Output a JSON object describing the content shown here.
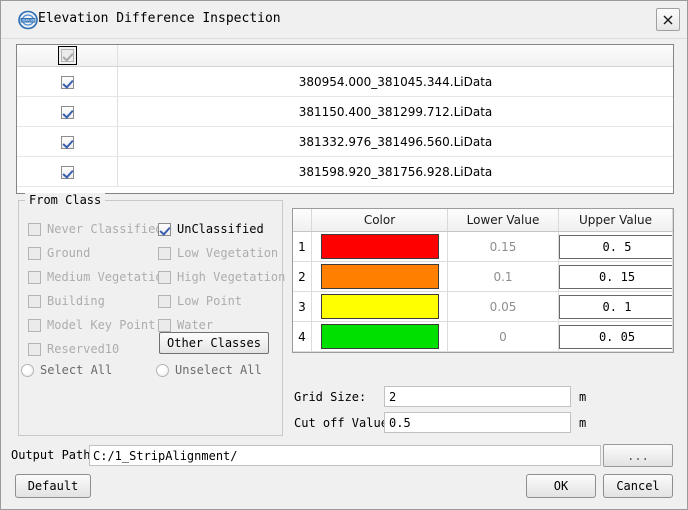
{
  "window": {
    "title": "Elevation Difference Inspection",
    "app_icon": "lidar360-logo-icon",
    "close_label": "close-icon"
  },
  "file_list": {
    "header_checkbox_state": "checked-disabled",
    "rows": [
      {
        "checked": true,
        "name": "380954.000_381045.344.LiData"
      },
      {
        "checked": true,
        "name": "381150.400_381299.712.LiData"
      },
      {
        "checked": true,
        "name": "381332.976_381496.560.LiData"
      },
      {
        "checked": true,
        "name": "381598.920_381756.928.LiData"
      }
    ]
  },
  "from_class": {
    "legend": "From Class",
    "items": [
      {
        "label": "Never Classified",
        "checked": false,
        "enabled": false
      },
      {
        "label": "UnClassified",
        "checked": true,
        "enabled": true
      },
      {
        "label": "Ground",
        "checked": false,
        "enabled": false
      },
      {
        "label": "Low Vegetation",
        "checked": false,
        "enabled": false
      },
      {
        "label": "Medium Vegetation",
        "checked": false,
        "enabled": false
      },
      {
        "label": "High Vegetation",
        "checked": false,
        "enabled": false
      },
      {
        "label": "Building",
        "checked": false,
        "enabled": false
      },
      {
        "label": "Low Point",
        "checked": false,
        "enabled": false
      },
      {
        "label": "Model Key Point",
        "checked": false,
        "enabled": false
      },
      {
        "label": "Water",
        "checked": false,
        "enabled": false
      },
      {
        "label": "Reserved10",
        "checked": false,
        "enabled": false
      }
    ],
    "other_classes_label": "Other Classes",
    "select_all_label": "Select All",
    "unselect_all_label": "Unselect All",
    "select_all_checked": false,
    "unselect_all_checked": false
  },
  "color_table": {
    "headers": {
      "index": "",
      "color": "Color",
      "lower": "Lower Value",
      "upper": "Upper Value"
    },
    "rows": [
      {
        "index": "1",
        "color": "#FF0000",
        "lower": "0.15",
        "upper": "0. 5"
      },
      {
        "index": "2",
        "color": "#FF8000",
        "lower": "0.1",
        "upper": "0. 15"
      },
      {
        "index": "3",
        "color": "#FFFF00",
        "lower": "0.05",
        "upper": "0. 1"
      },
      {
        "index": "4",
        "color": "#00E000",
        "lower": "0",
        "upper": "0. 05"
      }
    ]
  },
  "parameters": {
    "grid_size_label": "Grid Size:",
    "grid_size_value": "2",
    "grid_size_unit": "m",
    "cut_off_label": "Cut off Value:",
    "cut_off_value": "0.5",
    "cut_off_unit": "m"
  },
  "output": {
    "label": "Output Path:",
    "value": "C:/1_StripAlignment/",
    "browse_label": "..."
  },
  "buttons": {
    "default_label": "Default",
    "ok_label": "OK",
    "cancel_label": "Cancel"
  }
}
